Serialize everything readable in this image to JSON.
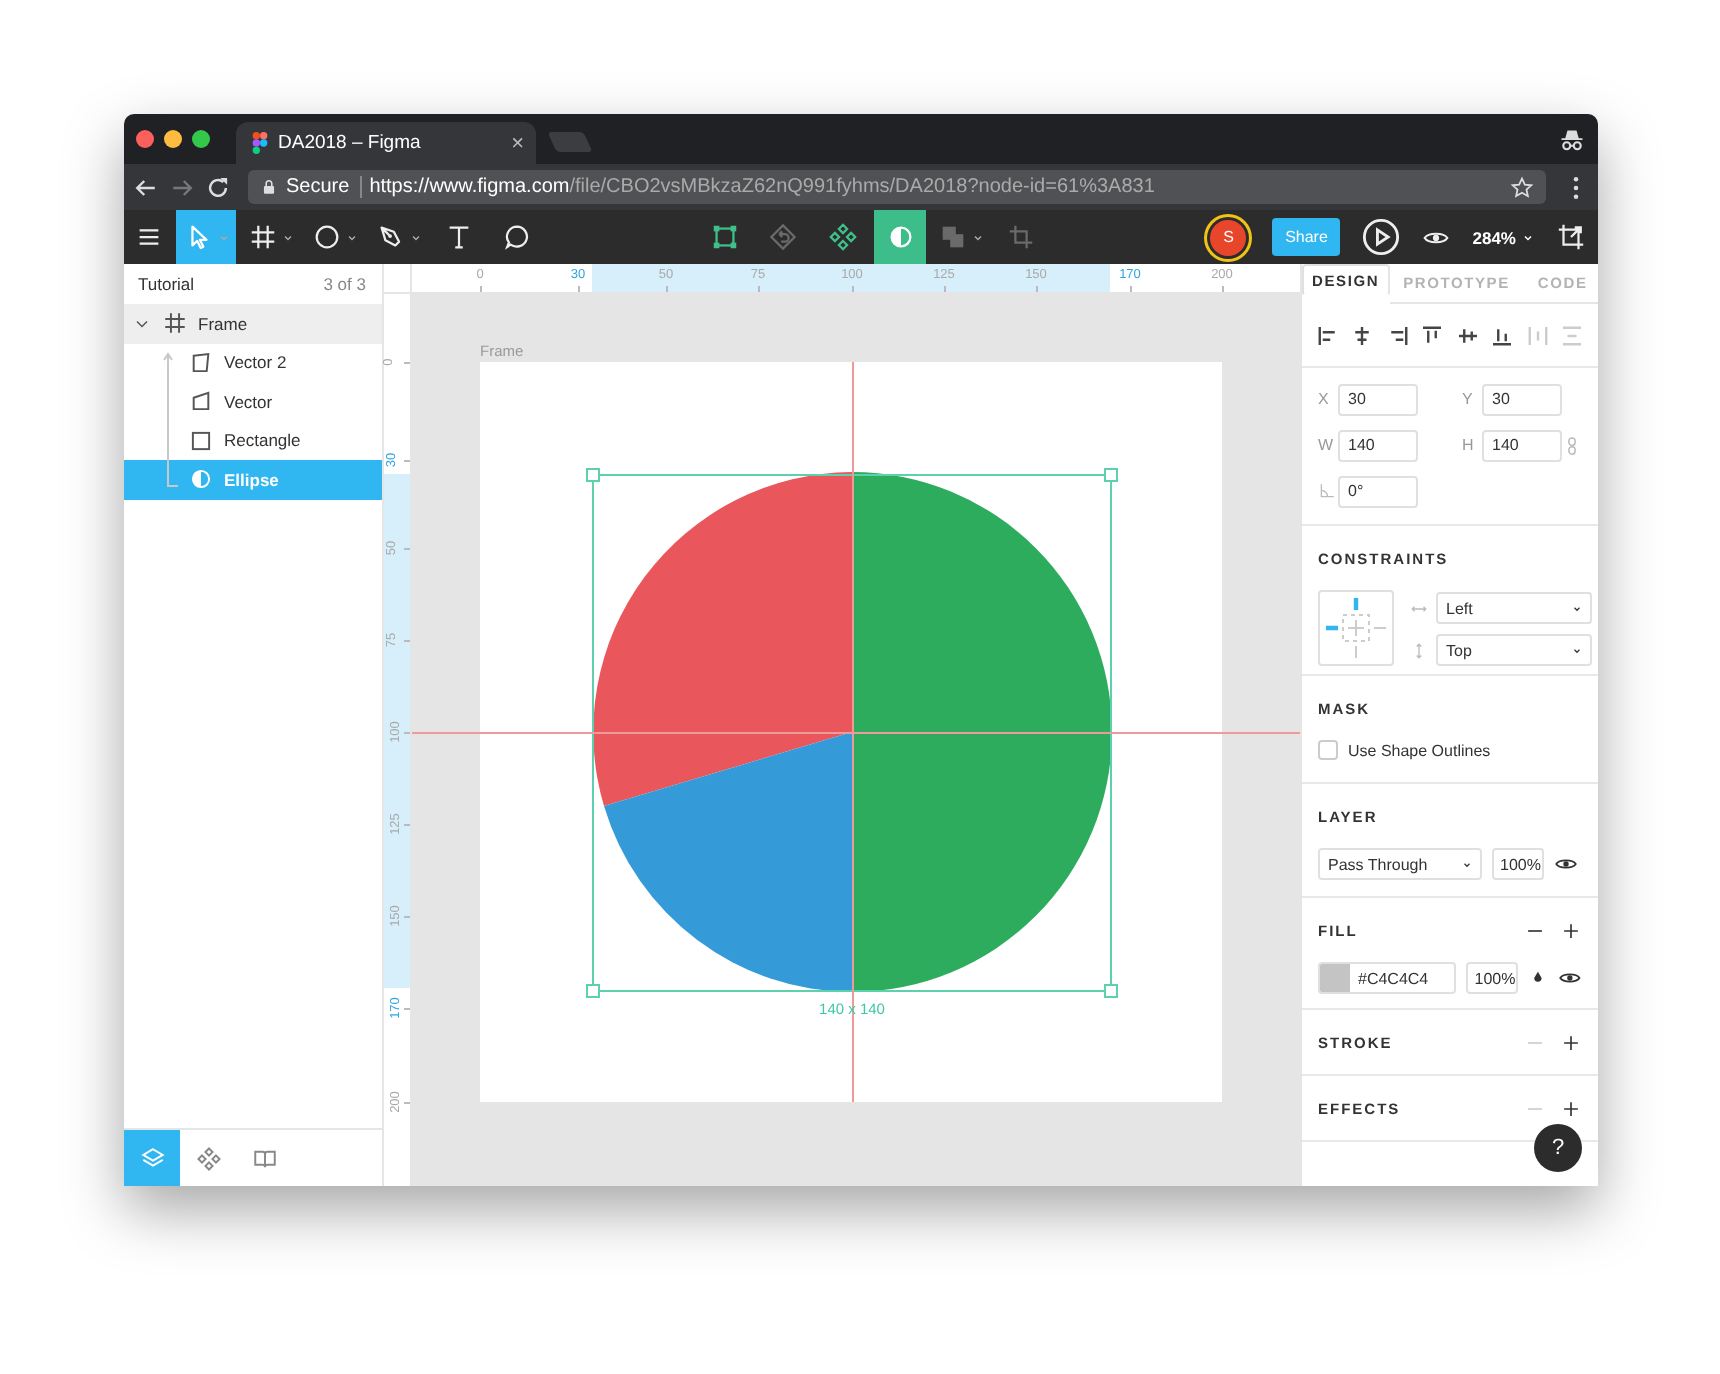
{
  "browser": {
    "tab_title": "DA2018 – Figma",
    "tab_close": "×",
    "secure": "Secure",
    "url_host": "https://www.figma.com",
    "url_path": "/file/CBO2vsMBkzaZ62nQ991fyhms/DA2018?node-id=61%3A831"
  },
  "toolbar": {
    "left_tools": [
      {
        "kind": "menu",
        "selected": false,
        "disabled": false,
        "dropdown": false
      },
      {
        "kind": "move",
        "selected": true,
        "disabled": false,
        "dropdown": true
      },
      {
        "kind": "frame",
        "selected": false,
        "disabled": false,
        "dropdown": true
      },
      {
        "kind": "ellipse",
        "selected": false,
        "disabled": false,
        "dropdown": true
      },
      {
        "kind": "pen",
        "selected": false,
        "disabled": false,
        "dropdown": true
      },
      {
        "kind": "text",
        "selected": false,
        "disabled": false,
        "dropdown": false
      },
      {
        "kind": "comment",
        "selected": false,
        "disabled": false,
        "dropdown": false
      }
    ],
    "center_tools": [
      {
        "kind": "bounds",
        "selected": false,
        "disabled": false,
        "dropdown": false
      },
      {
        "kind": "back",
        "selected": false,
        "disabled": true,
        "dropdown": false
      },
      {
        "kind": "component",
        "selected": false,
        "disabled": false,
        "dropdown": false
      },
      {
        "kind": "mask",
        "selected": true,
        "disabled": false,
        "dropdown": false
      },
      {
        "kind": "boolean",
        "selected": false,
        "disabled": true,
        "dropdown": true
      },
      {
        "kind": "crop",
        "selected": false,
        "disabled": true,
        "dropdown": false
      }
    ],
    "avatar": "S",
    "share": "Share",
    "zoom": "284%"
  },
  "layers_panel": {
    "title": "Tutorial",
    "count": "3 of 3",
    "layers": [
      {
        "name": "Frame",
        "kind": "frame",
        "expanded": true,
        "highlighted": true,
        "selected": false,
        "children": [
          {
            "name": "Vector 2",
            "kind": "vector2",
            "selected": false
          },
          {
            "name": "Vector",
            "kind": "vector",
            "selected": false
          },
          {
            "name": "Rectangle",
            "kind": "rectangle",
            "selected": false
          },
          {
            "name": "Ellipse",
            "kind": "ellipse",
            "selected": true
          }
        ]
      }
    ],
    "bottom_tabs": [
      {
        "kind": "layers",
        "selected": true
      },
      {
        "kind": "components",
        "selected": false
      },
      {
        "kind": "library",
        "selected": false
      }
    ]
  },
  "canvas": {
    "frame_label": "Frame",
    "size_label": "140 x 140",
    "ruler_x": [
      {
        "label": "0",
        "highlighted": false
      },
      {
        "label": "30",
        "highlighted": true
      },
      {
        "label": "50",
        "highlighted": false
      },
      {
        "label": "75",
        "highlighted": false
      },
      {
        "label": "100",
        "highlighted": false
      },
      {
        "label": "125",
        "highlighted": false
      },
      {
        "label": "150",
        "highlighted": false
      },
      {
        "label": "170",
        "highlighted": true
      },
      {
        "label": "200",
        "highlighted": false
      }
    ],
    "ruler_y": [
      {
        "label": "0",
        "highlighted": false
      },
      {
        "label": "30",
        "highlighted": true
      },
      {
        "label": "50",
        "highlighted": false
      },
      {
        "label": "75",
        "highlighted": false
      },
      {
        "label": "100",
        "highlighted": false
      },
      {
        "label": "125",
        "highlighted": false
      },
      {
        "label": "150",
        "highlighted": false
      },
      {
        "label": "170",
        "highlighted": true
      },
      {
        "label": "200",
        "highlighted": false
      }
    ]
  },
  "properties": {
    "tabs": [
      {
        "label": "DESIGN",
        "selected": true
      },
      {
        "label": "PROTOTYPE",
        "selected": false
      },
      {
        "label": "CODE",
        "selected": false
      }
    ],
    "align_tools": [
      {
        "kind": "left",
        "disabled": false
      },
      {
        "kind": "hcenter",
        "disabled": false
      },
      {
        "kind": "right",
        "disabled": false
      },
      {
        "kind": "top",
        "disabled": false
      },
      {
        "kind": "vcenter",
        "disabled": false
      },
      {
        "kind": "bottom",
        "disabled": false
      },
      {
        "kind": "hdist",
        "disabled": true
      },
      {
        "kind": "vdist",
        "disabled": true
      }
    ],
    "fields": [
      {
        "label": "X",
        "value": "30"
      },
      {
        "label": "Y",
        "value": "30"
      },
      {
        "label": "W",
        "value": "140"
      },
      {
        "label": "H",
        "value": "140"
      }
    ],
    "rotation": "0°",
    "constraints": {
      "title": "CONSTRAINTS",
      "horizontal": "Left",
      "vertical": "Top"
    },
    "mask": {
      "title": "MASK",
      "label": "Use Shape Outlines",
      "checked": false
    },
    "layer": {
      "title": "LAYER",
      "blend": "Pass Through",
      "opacity": "100%"
    },
    "fill": {
      "title": "FILL",
      "color": "#c4c4c4",
      "hex": "#C4C4C4",
      "opacity": "100%",
      "remove_disabled": false
    },
    "stroke": {
      "title": "STROKE",
      "remove_disabled": true
    },
    "effects": {
      "title": "EFFECTS",
      "remove_disabled": true
    },
    "help": "?"
  }
}
